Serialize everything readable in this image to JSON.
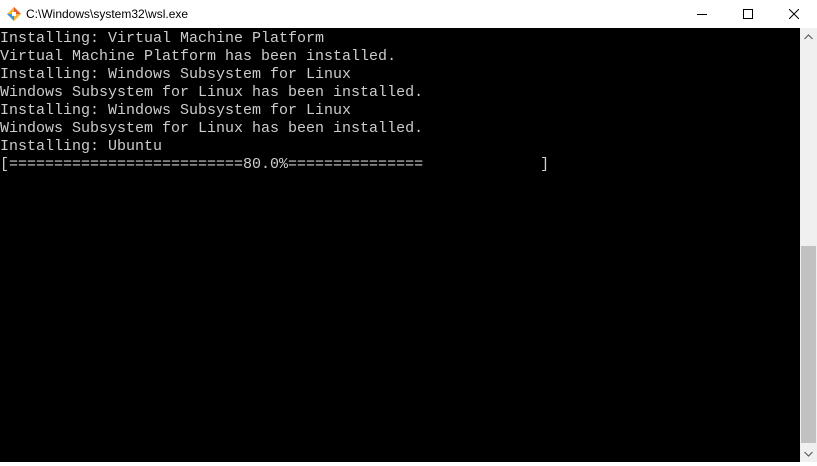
{
  "window": {
    "title": "C:\\Windows\\system32\\wsl.exe",
    "app_icon": "wsl-penguin-icon",
    "buttons": {
      "minimize": "minimize-icon",
      "maximize": "maximize-icon",
      "close": "close-icon"
    }
  },
  "console": {
    "lines": [
      "Installing: Virtual Machine Platform",
      "Virtual Machine Platform has been installed.",
      "Installing: Windows Subsystem for Linux",
      "Windows Subsystem for Linux has been installed.",
      "Installing: Windows Subsystem for Linux",
      "Windows Subsystem for Linux has been installed.",
      "Installing: Ubuntu",
      "[==========================80.0%===============             ]"
    ],
    "progress_percent": 80.0,
    "text_color": "#cccccc",
    "background": "#000000"
  },
  "scrollbar": {
    "up_arrow": "scroll-up-icon",
    "down_arrow": "scroll-down-icon",
    "position_fraction": 1.0
  }
}
